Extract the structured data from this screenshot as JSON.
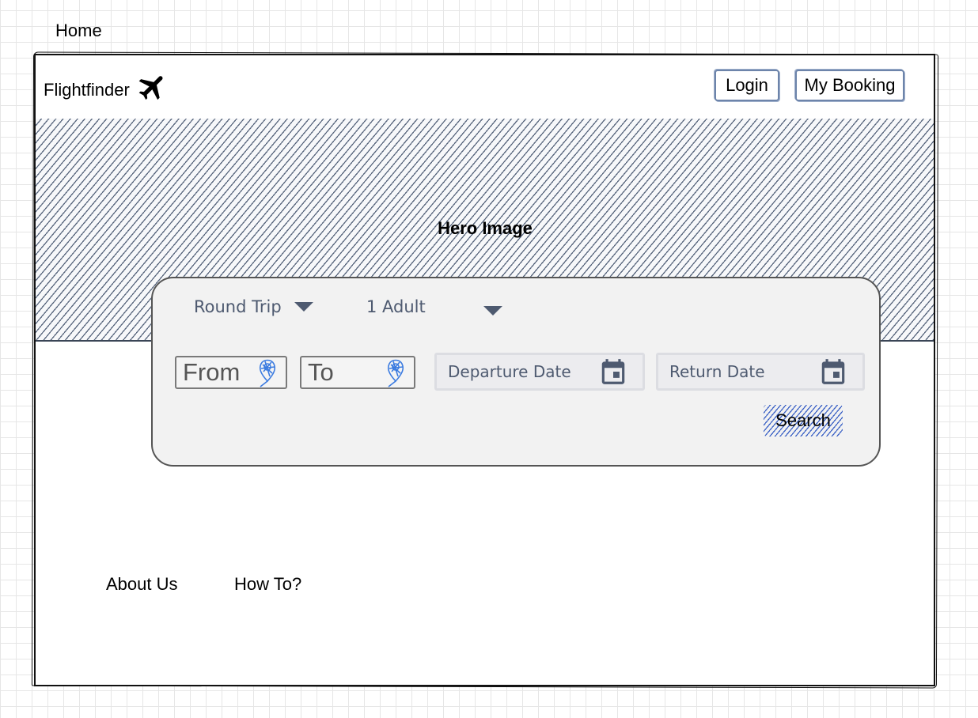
{
  "page": {
    "label": "Home"
  },
  "header": {
    "brand": "Flightfinder",
    "brand_icon": "airplane-icon",
    "login_label": "Login",
    "booking_label": "My Booking"
  },
  "hero": {
    "label": "Hero Image"
  },
  "search": {
    "trip_type": "Round Trip",
    "passengers": "1 Adult",
    "from_placeholder": "From",
    "to_placeholder": "To",
    "departure_placeholder": "Departure Date",
    "return_placeholder": "Return Date",
    "search_label": "Search",
    "location_icon": "location-pin-icon",
    "date_icon": "calendar-icon"
  },
  "footer": {
    "about_label": "About Us",
    "howto_label": "How To?"
  },
  "colors": {
    "accent": "#3d63c6",
    "frame": "#3a4556",
    "hatch": "#58667d",
    "panel": "#f2f2f2"
  }
}
